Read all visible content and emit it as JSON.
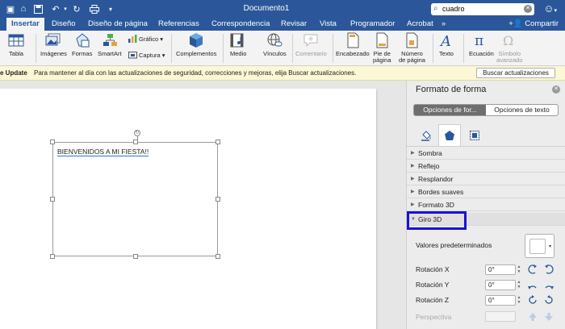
{
  "window": {
    "title": "Documento1"
  },
  "search": {
    "value": "cuadro"
  },
  "tabs": [
    "Insertar",
    "Diseño",
    "Diseño de página",
    "Referencias",
    "Correspondencia",
    "Revisar",
    "Vista",
    "Programador",
    "Acrobat",
    "»"
  ],
  "share_label": "Compartir",
  "ribbon": {
    "tabla": "Tabla",
    "imagenes": "Imágenes",
    "formas": "Formas",
    "smartart": "SmartArt",
    "grafico": "Gráfico",
    "captura": "Captura",
    "complementos": "Complementos",
    "medio": "Medio",
    "vinculos": "Vínculos",
    "comentario": "Comentario",
    "encabezado": "Encabezado",
    "pie1": "Pie de",
    "pie2": "página",
    "numero1": "Número",
    "numero2": "de página",
    "texto": "Texto",
    "ecuacion": "Ecuación",
    "simbolo1": "Símbolo",
    "simbolo2": "avanzado"
  },
  "message_bar": {
    "label": "e Update",
    "text": "Para mantener al día con las actualizaciones de seguridad, correcciones y mejoras, elija Buscar actualizaciones.",
    "button": "Buscar actualizaciones"
  },
  "document": {
    "shape_text": "BIENVENIDOS A MI FIESTA!!"
  },
  "pane": {
    "title": "Formato de forma",
    "seg_shape": "Opciones de for...",
    "seg_text": "Opciones de texto",
    "sections": [
      "Sombra",
      "Reflejo",
      "Resplandor",
      "Bordes suaves",
      "Formato 3D",
      "Giro 3D"
    ],
    "presets_label": "Valores predeterminados",
    "rot_x_label": "Rotación X",
    "rot_y_label": "Rotación Y",
    "rot_z_label": "Rotación Z",
    "perspective_label": "Perspectiva",
    "rot_x": "0°",
    "rot_y": "0°",
    "rot_z": "0°"
  },
  "colors": {
    "brand": "#2b579a",
    "highlight": "#1a10d8"
  }
}
